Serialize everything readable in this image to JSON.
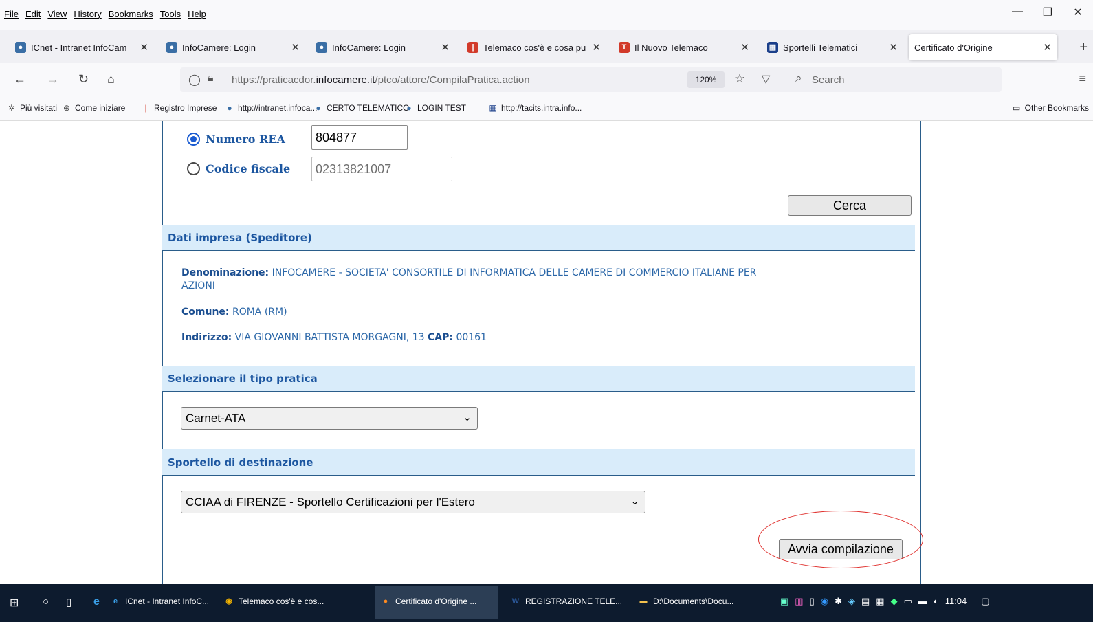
{
  "menubar": [
    "File",
    "Edit",
    "View",
    "History",
    "Bookmarks",
    "Tools",
    "Help"
  ],
  "window_controls": {
    "minimize": "—",
    "restore": "❐",
    "close": "✕"
  },
  "tabs": [
    {
      "label": "ICnet - Intranet InfoCam",
      "icon": "infocamere-icon",
      "color": "#3a6ea5"
    },
    {
      "label": "InfoCamere: Login",
      "icon": "infocamere-icon",
      "color": "#3a6ea5"
    },
    {
      "label": "InfoCamere: Login",
      "icon": "infocamere-icon",
      "color": "#3a6ea5"
    },
    {
      "label": "Telemaco cos'è e cosa pu",
      "icon": "telemaco-icon",
      "color": "#d23a2a"
    },
    {
      "label": "Il Nuovo Telemaco",
      "icon": "telemaco-t-icon",
      "color": "#d23a2a"
    },
    {
      "label": "Sportelli Telematici",
      "icon": "sportelli-icon",
      "color": "#1b3f8a"
    },
    {
      "label": "Certificato d'Origine",
      "icon": "",
      "color": ""
    }
  ],
  "navbar": {
    "url_prefix": "https://praticacdor.",
    "url_domain": "infocamere.it",
    "url_path": "/ptco/attore/CompilaPratica.action",
    "zoom": "120%",
    "search_placeholder": "Search"
  },
  "bookmarks": [
    {
      "label": "Più visitati",
      "icon": "gear-icon"
    },
    {
      "label": "Come iniziare",
      "icon": "globe-icon"
    },
    {
      "label": "Registro Imprese",
      "icon": "registro-icon"
    },
    {
      "label": "http://intranet.infoca...",
      "icon": "infocamere-icon"
    },
    {
      "label": "CERTO TELEMATICO",
      "icon": "infocamere-icon"
    },
    {
      "label": "LOGIN TEST",
      "icon": "infocamere-icon"
    },
    {
      "label": "http://tacits.intra.info...",
      "icon": "sportelli-icon"
    }
  ],
  "other_bookmarks": "Other Bookmarks",
  "search": {
    "rea_label": "Numero REA",
    "rea_value": "804877",
    "cf_label": "Codice fiscale",
    "cf_value": "02313821007",
    "selected": "rea",
    "button": "Cerca"
  },
  "impresa": {
    "title": "Dati impresa (Speditore)",
    "denominazione_label": "Denominazione:",
    "denominazione_line1": "INFOCAMERE - SOCIETA' CONSORTILE DI INFORMATICA DELLE CAMERE DI COMMERCIO ITALIANE PER",
    "denominazione_line2": "AZIONI",
    "comune_label": "Comune:",
    "comune": "ROMA  (RM)",
    "indirizzo_label": "Indirizzo:",
    "indirizzo": "VIA GIOVANNI BATTISTA MORGAGNI, 13",
    "cap_label": "CAP:",
    "cap": "00161"
  },
  "tipo_pratica": {
    "title": "Selezionare il tipo pratica",
    "value": "Carnet-ATA"
  },
  "sportello": {
    "title": "Sportello di destinazione",
    "value": "CCIAA di FIRENZE - Sportello Certificazioni per l'Estero"
  },
  "avvia_button": "Avvia compilazione",
  "taskbar": {
    "items": [
      {
        "label": "ICnet - Intranet InfoC...",
        "icon": "ie-icon"
      },
      {
        "label": "Telemaco cos'è e cos...",
        "icon": "chrome-icon"
      },
      {
        "label": "Certificato d'Origine ...",
        "icon": "firefox-icon"
      },
      {
        "label": "REGISTRAZIONE TELE...",
        "icon": "word-icon"
      },
      {
        "label": "D:\\Documents\\Docu...",
        "icon": "folder-icon"
      }
    ],
    "clock": "11:04"
  },
  "colors": {
    "section_bg": "#d9ecfa",
    "label_blue": "#1c56a0",
    "highlight_ellipse": "#e0322f"
  }
}
